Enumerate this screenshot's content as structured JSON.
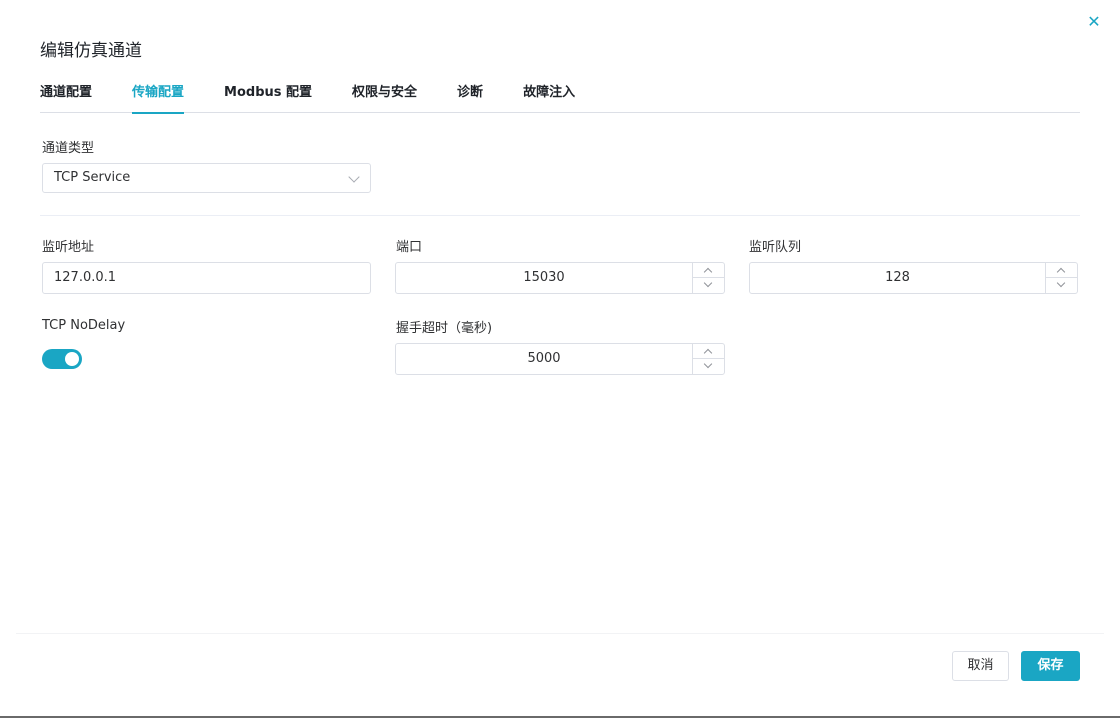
{
  "dialog": {
    "title": "编辑仿真通道",
    "close_icon": "close-icon",
    "accent_color": "#1aa6c4"
  },
  "tabs": [
    {
      "label": "通道配置",
      "active": false
    },
    {
      "label": "传输配置",
      "active": true
    },
    {
      "label": "Modbus 配置",
      "active": false
    },
    {
      "label": "权限与安全",
      "active": false
    },
    {
      "label": "诊断",
      "active": false
    },
    {
      "label": "故障注入",
      "active": false
    }
  ],
  "form": {
    "channel_type": {
      "label": "通道类型",
      "value": "TCP Service",
      "icon": "chevron-down-icon"
    },
    "listen_address": {
      "label": "监听地址",
      "value": "127.0.0.1"
    },
    "port": {
      "label": "端口",
      "value": "15030"
    },
    "listen_queue": {
      "label": "监听队列",
      "value": "128"
    },
    "tcp_nodelay": {
      "label": "TCP NoDelay",
      "enabled": true
    },
    "handshake_timeout": {
      "label": "握手超时（毫秒)",
      "value": "5000"
    }
  },
  "footer": {
    "cancel_label": "取消",
    "save_label": "保存"
  }
}
